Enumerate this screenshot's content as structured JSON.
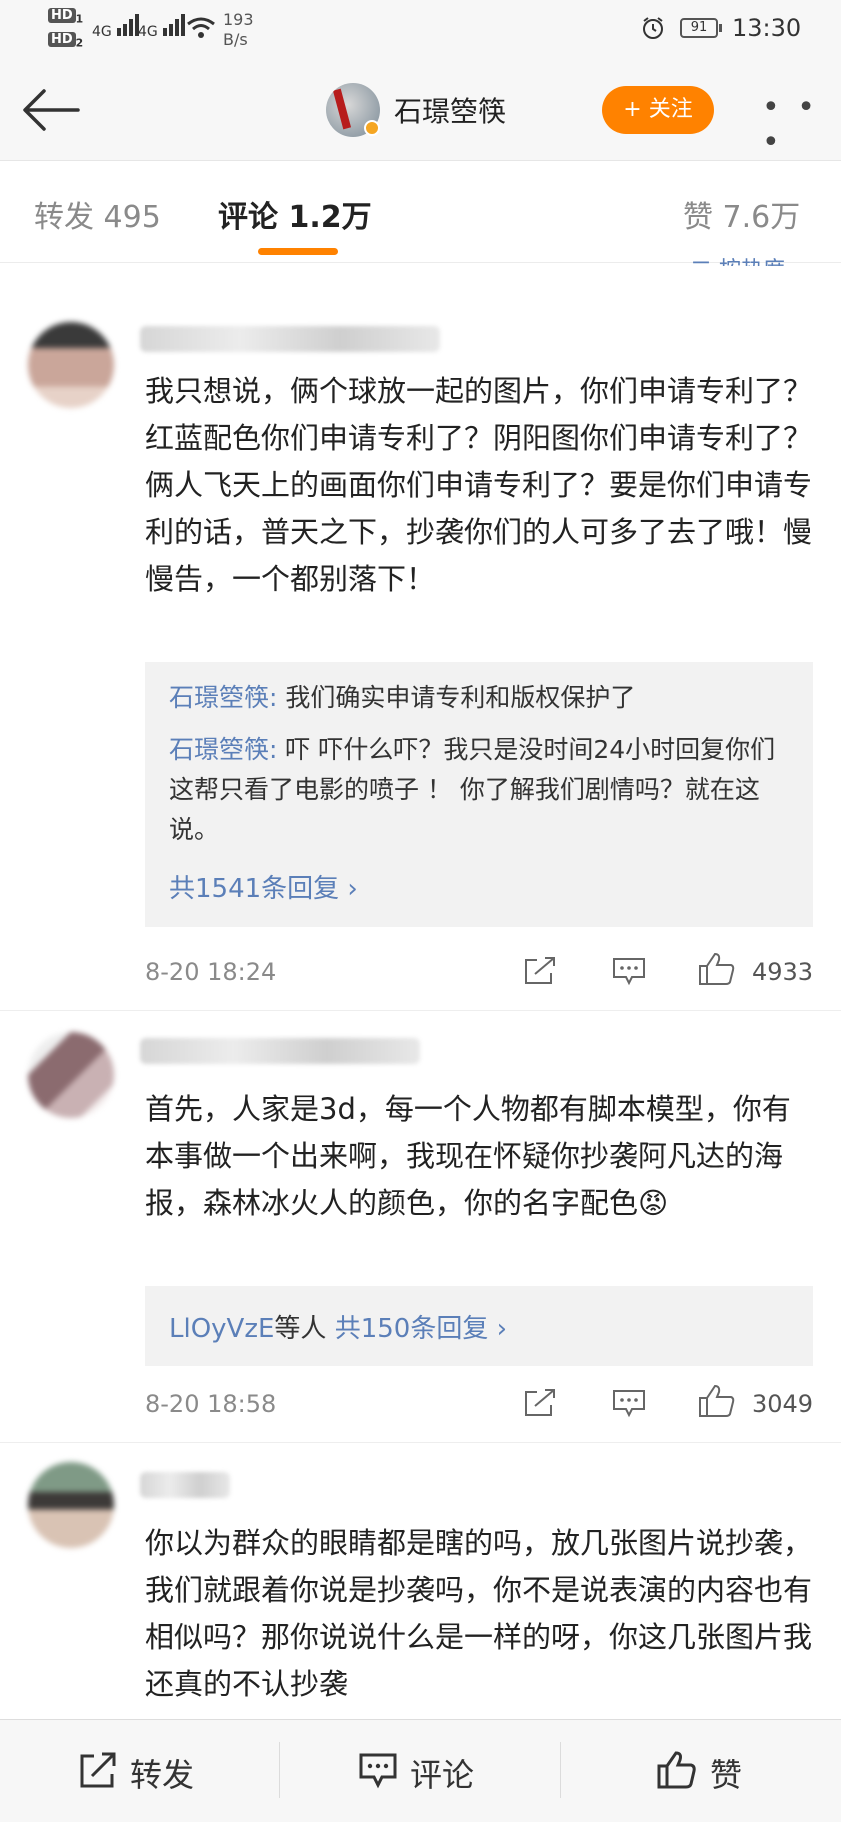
{
  "status_bar": {
    "hd1": "HD",
    "hd1_sub": "1",
    "hd2": "HD",
    "hd2_sub": "2",
    "net1": "4G",
    "net2": "4G",
    "speed_value": "193",
    "speed_unit": "B/s",
    "battery": "91",
    "time": "13:30"
  },
  "header": {
    "author": "石璟箜筷",
    "follow_label": "+ 关注",
    "more_label": "• • •"
  },
  "tabs": {
    "repost": "转发 495",
    "comments": "评论 1.2万",
    "likes": "赞 7.6万",
    "sort_partial": "二 按热度"
  },
  "comments": [
    {
      "text": "我只想说，俩个球放一起的图片，你们申请专利了？红蓝配色你们申请专利了？阴阳图你们申请专利了？俩人飞天上的画面你们申请专利了？要是你们申请专利的话，普天之下，抄袭你们的人可多了去了哦！慢慢告，一个都别落下！",
      "replies": [
        {
          "name": "石璟箜筷",
          "sep": ": ",
          "text": "我们确实申请专利和版权保护了"
        },
        {
          "name": "石璟箜筷",
          "sep": ": ",
          "text": "吓 吓什么吓？我只是没时间24小时回复你们这帮只看了电影的喷子 ！ 你了解我们剧情吗？就在这说。"
        }
      ],
      "more_replies": "共1541条回复 ›",
      "time": "8-20 18:24",
      "likes": "4933"
    },
    {
      "text": "首先，人家是3d，每一个人物都有脚本模型，你有本事做一个出来啊，我现在怀疑你抄袭阿凡达的海报，森林冰火人的颜色，你的名字配色😡",
      "more_name": "LlOyVzE",
      "more_mid": "等人",
      "more_replies": "共150条回复 ›",
      "time": "8-20 18:58",
      "likes": "3049"
    },
    {
      "text": "你以为群众的眼睛都是瞎的吗，放几张图片说抄袭，我们就跟着你说是抄袭吗，你不是说表演的内容也有相似吗？那你说说什么是一样的呀，你这几张图片我还真的不认抄袭"
    }
  ],
  "bottom_bar": {
    "repost": "转发",
    "comment": "评论",
    "like": "赞"
  },
  "colors": {
    "accent": "#ff8200",
    "link": "#5b7fb8"
  }
}
